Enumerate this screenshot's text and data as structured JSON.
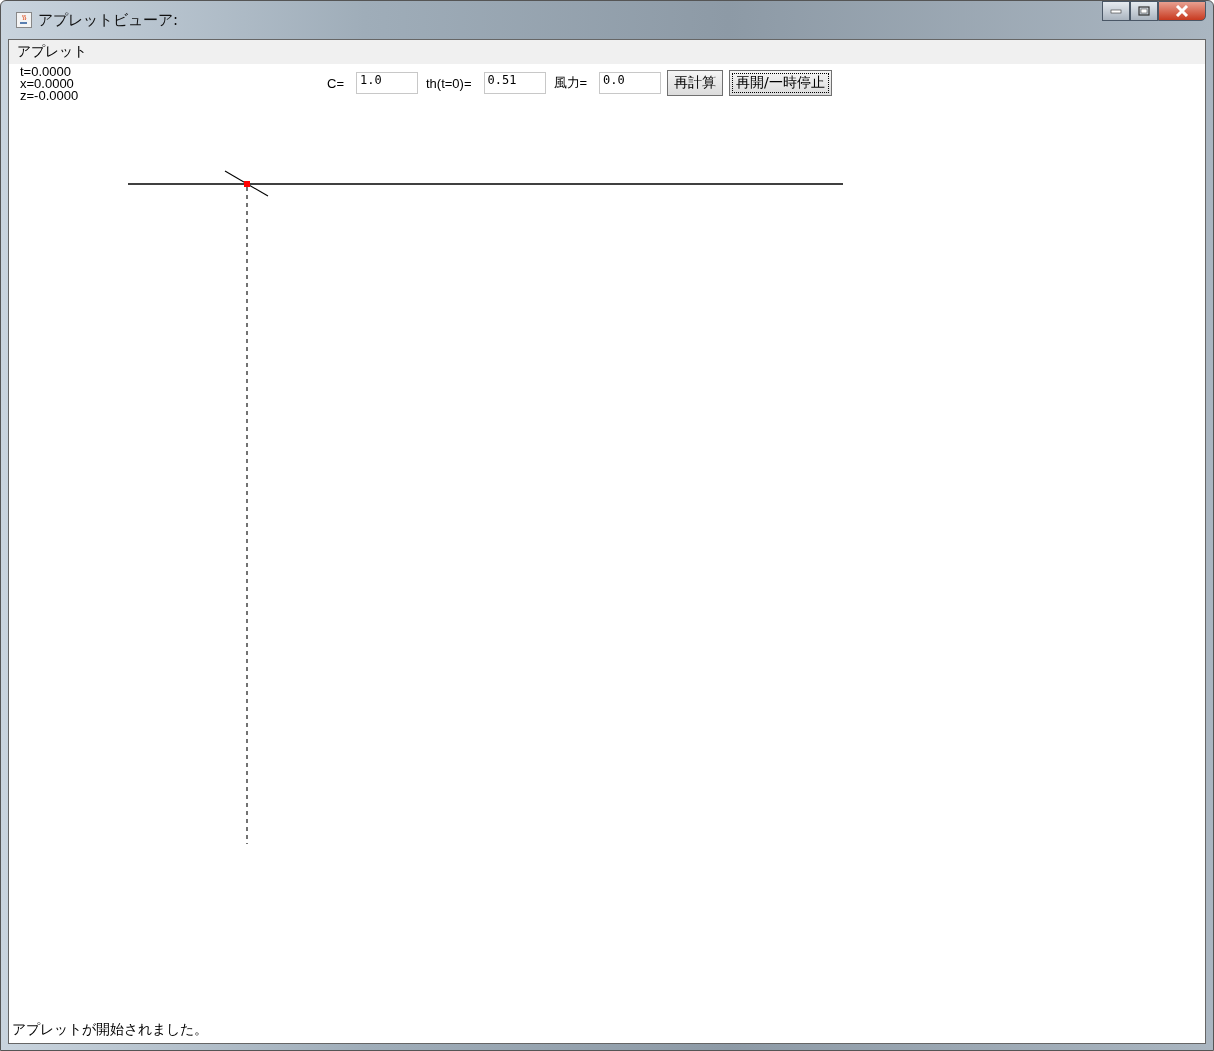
{
  "window": {
    "title": "アプレットビューア:"
  },
  "menu": [
    {
      "label": "アプレット"
    }
  ],
  "readouts": [
    "t=0.0000",
    "x=0.0000",
    "z=-0.0000"
  ],
  "fields": [
    {
      "label": "C=",
      "value": "1.0"
    },
    {
      "label": "th(t=0)=",
      "value": "0.51"
    },
    {
      "label": "風力=",
      "value": "0.0"
    }
  ],
  "buttons": [
    {
      "label": "再計算",
      "focused": false
    },
    {
      "label": "再開/一時停止",
      "focused": true
    }
  ],
  "status_bar": "アプレットが開始されました。"
}
